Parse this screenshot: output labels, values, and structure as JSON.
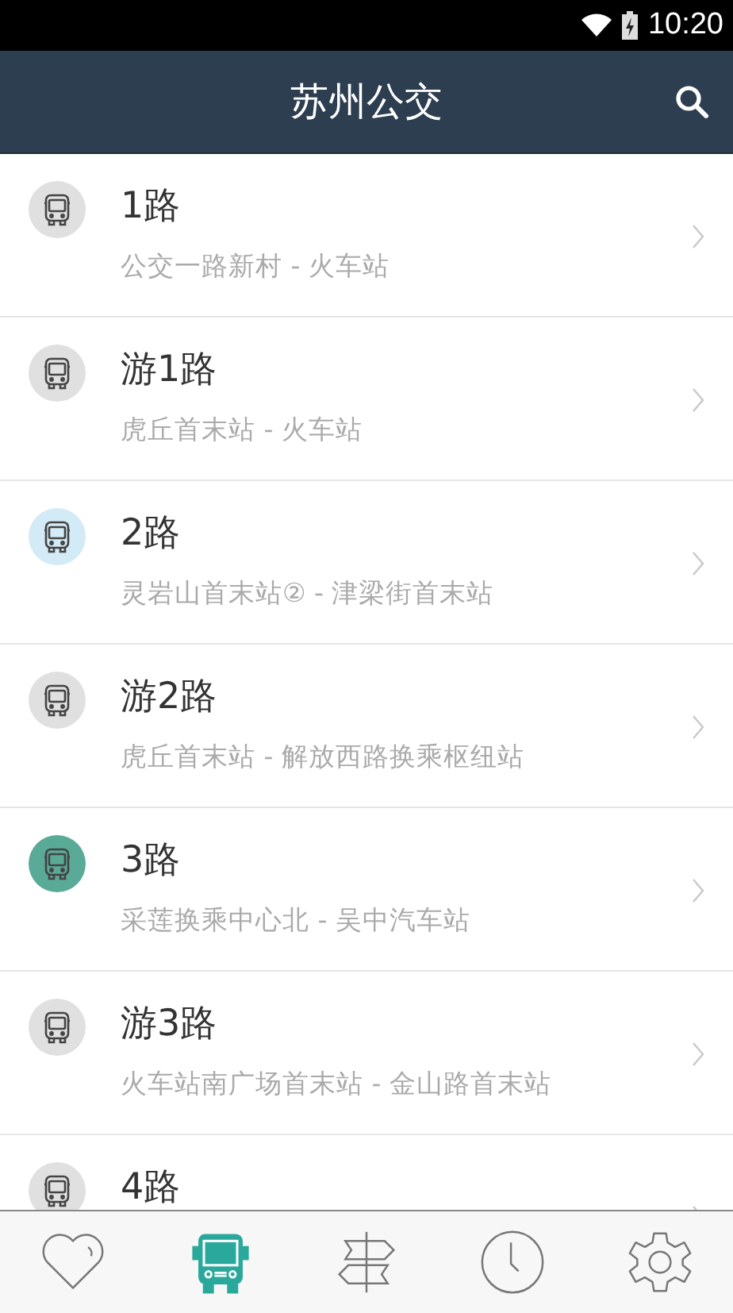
{
  "status_bar": {
    "time": "10:20"
  },
  "header": {
    "title": "苏州公交"
  },
  "routes": [
    {
      "name": "1路",
      "stops": "公交一路新村 - 火车站",
      "color": "#e0e0e0"
    },
    {
      "name": "游1路",
      "stops": "虎丘首末站 - 火车站",
      "color": "#e0e0e0"
    },
    {
      "name": "2路",
      "stops": "灵岩山首末站② - 津梁街首末站",
      "color": "#d3eaf7"
    },
    {
      "name": "游2路",
      "stops": "虎丘首末站 - 解放西路换乘枢纽站",
      "color": "#e0e0e0"
    },
    {
      "name": "3路",
      "stops": "采莲换乘中心北 - 吴中汽车站",
      "color": "#5aaa98"
    },
    {
      "name": "游3路",
      "stops": "火车站南广场首末站 - 金山路首末站",
      "color": "#e0e0e0"
    },
    {
      "name": "4路",
      "color": "#e0e0e0"
    }
  ],
  "tabs": [
    {
      "kind": "favorites",
      "selected": false
    },
    {
      "kind": "bus",
      "selected": true
    },
    {
      "kind": "transfer",
      "selected": false
    },
    {
      "kind": "history",
      "selected": false
    },
    {
      "kind": "settings",
      "selected": false
    }
  ]
}
